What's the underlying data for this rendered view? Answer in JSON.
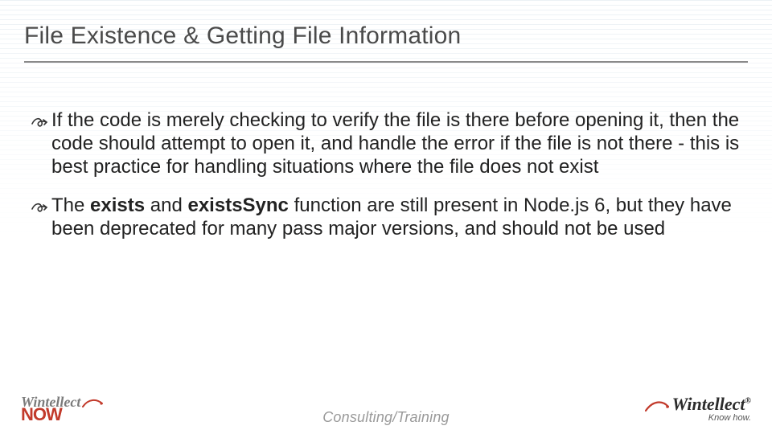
{
  "title": "File Existence & Getting File Information",
  "bullets": [
    {
      "pre": "If the code is merely checking to verify the file is there before opening it, then the code should attempt to open it, and handle the error if the file is not there - this is best practice for handling situations where the file does not exist",
      "bolds": []
    },
    {
      "pre": "The ",
      "b1": "exists",
      "mid1": " and ",
      "b2": "existsSync",
      "post": " function are still present in Node.js 6, but they have been deprecated for many pass major versions, and should not be used"
    }
  ],
  "footer": {
    "center": "Consulting/Training",
    "left": {
      "line1": "Wintellect",
      "line2": "NOW"
    },
    "right": {
      "brand": "Wintellect",
      "reg": "®",
      "tag": "Know how."
    }
  },
  "icons": {
    "bullet_arrow": "curly-arrow-icon",
    "swoosh": "swoosh-icon"
  }
}
